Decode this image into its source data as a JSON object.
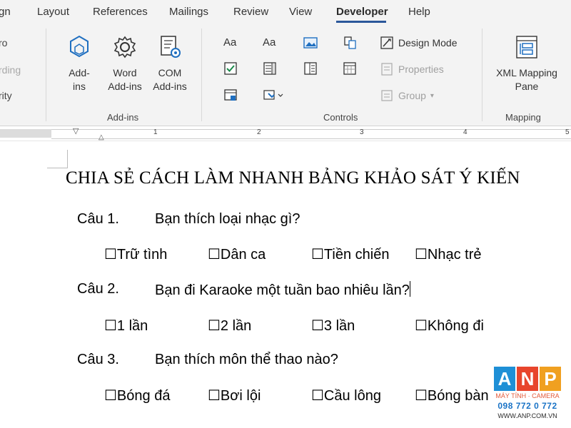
{
  "tabs": {
    "partial_first": "gn",
    "items": [
      "Layout",
      "References",
      "Mailings",
      "Review",
      "View",
      "Developer",
      "Help"
    ],
    "active": "Developer"
  },
  "ribbon": {
    "left_partial": [
      "ro",
      "rding",
      "rity"
    ],
    "addins": {
      "group_label": "Add-ins",
      "addins_btn": "Add-\nins",
      "word_addins_btn": "Word\nAdd-ins",
      "com_addins_btn": "COM\nAdd-ins"
    },
    "controls": {
      "group_label": "Controls",
      "aa1": "Aa",
      "aa2": "Aa",
      "design_mode": "Design Mode",
      "properties": "Properties",
      "group": "Group"
    },
    "mapping": {
      "group_label": "Mapping",
      "xml_pane": "XML Mapping\nPane"
    }
  },
  "ruler": {
    "numbers": [
      "1",
      "2",
      "3",
      "4",
      "5"
    ]
  },
  "document": {
    "title": "CHIA SẺ CÁCH LÀM NHANH BẢNG KHẢO SÁT Ý KIẾN",
    "questions": [
      {
        "num": "Câu 1.",
        "text": "Bạn thích loại nhạc gì?",
        "options": [
          "☐Trữ tình",
          "☐Dân ca",
          "☐Tiền chiến",
          "☐Nhạc trẻ"
        ]
      },
      {
        "num": "Câu 2.",
        "text": "Bạn đi Karaoke một tuần bao nhiêu lần?",
        "options": [
          "☐1 lần",
          "☐2 lần",
          "☐3 lần",
          "☐Không đi"
        ]
      },
      {
        "num": "Câu 3.",
        "text": "Bạn thích môn thể thao nào?",
        "options": [
          "☐Bóng đá",
          "☐Bơi lội",
          "☐Cầu lông",
          "☐Bóng bàn"
        ]
      }
    ]
  },
  "watermark": {
    "letters": [
      "A",
      "N",
      "P"
    ],
    "colors": [
      "#1e8fd6",
      "#e8452c",
      "#f0a020"
    ],
    "subtitle": "MÁY TÍNH · CAMERA",
    "phone": "098 772 0 772",
    "website": "WWW.ANP.COM.VN"
  },
  "colors": {
    "accent": "#2b579a",
    "ribbon_bg": "#f3f3f3"
  }
}
